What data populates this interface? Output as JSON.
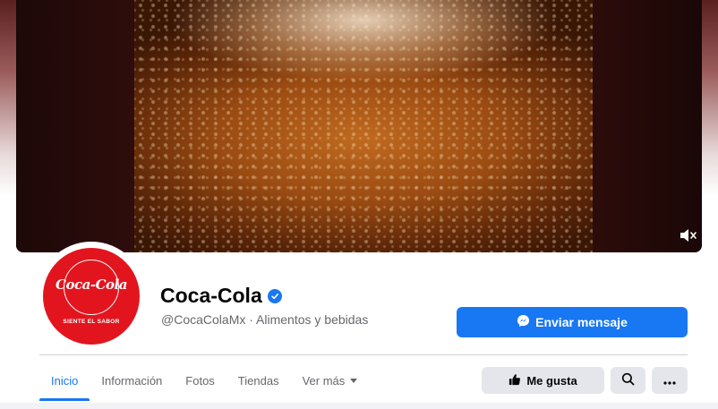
{
  "page": {
    "name": "Coca-Cola",
    "handle": "@CocaColaMx",
    "category": "Alimentos y bebidas",
    "separator": " · ",
    "verified": true
  },
  "avatar": {
    "logo_text": "Coca-Cola",
    "tagline": "SIENTE EL SABOR"
  },
  "cover": {
    "type": "video",
    "muted": true,
    "mute_icon": "speaker-muted-icon"
  },
  "actions": {
    "message_label": "Enviar mensaje",
    "message_icon": "messenger-icon",
    "like_label": "Me gusta",
    "like_icon": "thumbs-up-icon",
    "search_icon": "search-icon",
    "more_icon": "more-horizontal-icon"
  },
  "tabs": [
    {
      "label": "Inicio",
      "active": true
    },
    {
      "label": "Información",
      "active": false
    },
    {
      "label": "Fotos",
      "active": false
    },
    {
      "label": "Tiendas",
      "active": false
    },
    {
      "label": "Ver más",
      "active": false,
      "dropdown": true
    }
  ],
  "colors": {
    "accent": "#1877f2",
    "brand_red": "#e2151f",
    "text_primary": "#050505",
    "text_secondary": "#65676b",
    "button_grey": "#e4e6eb"
  }
}
